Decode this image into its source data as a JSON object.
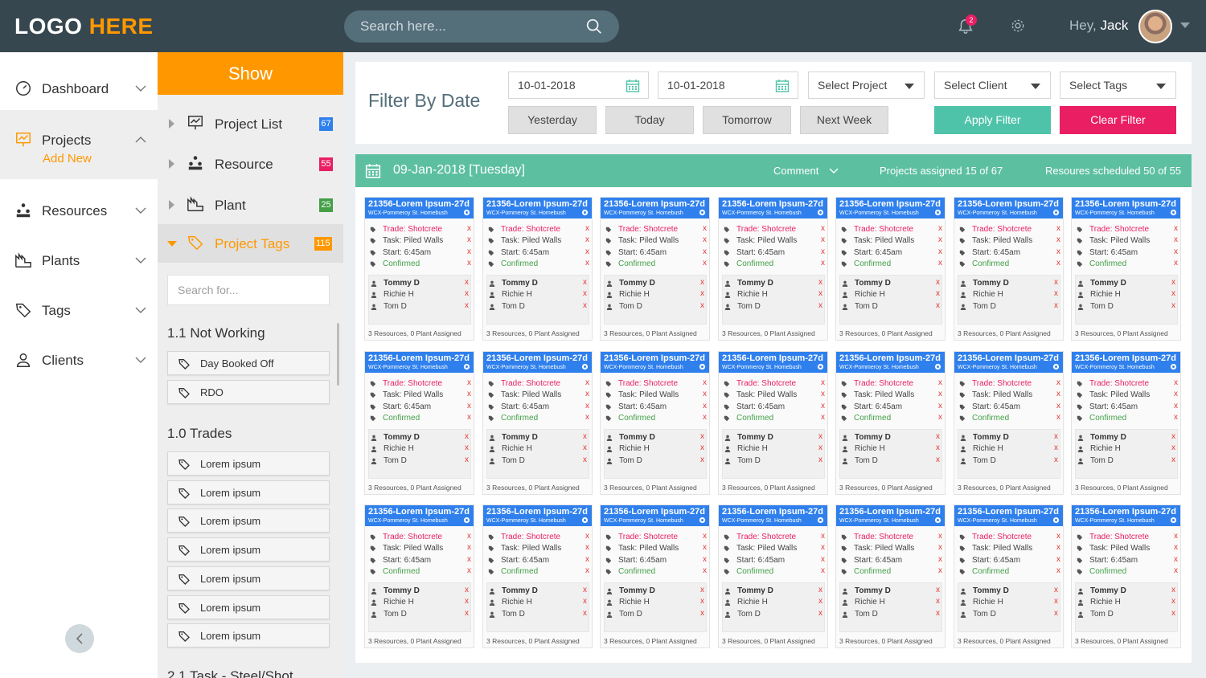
{
  "header": {
    "logo_main": "LOGO",
    "logo_accent": "HERE",
    "search_placeholder": "Search here...",
    "notifications_count": "2",
    "greeting": "Hey,",
    "user_name": "Jack"
  },
  "leftnav": {
    "items": [
      {
        "label": "Dashboard",
        "icon": "dashboard-icon"
      },
      {
        "label": "Projects",
        "icon": "projects-icon",
        "sub": "Add New"
      },
      {
        "label": "Resources",
        "icon": "resources-icon"
      },
      {
        "label": "Plants",
        "icon": "plants-icon"
      },
      {
        "label": "Tags",
        "icon": "tags-icon"
      },
      {
        "label": "Clients",
        "icon": "clients-icon"
      }
    ]
  },
  "show": {
    "title": "Show",
    "tree": [
      {
        "label": "Project List",
        "count": "67",
        "color": "#2f80ed"
      },
      {
        "label": "Resource",
        "count": "55",
        "color": "#e91e63"
      },
      {
        "label": "Plant",
        "count": "25",
        "color": "#43a047"
      },
      {
        "label": "Project Tags",
        "count": "115",
        "color": "#ff9800"
      }
    ],
    "search_placeholder": "Search for...",
    "section_not_working": "1.1 Not Working",
    "not_working": [
      "Day Booked Off",
      "RDO"
    ],
    "section_trades": "1.0 Trades",
    "trades": [
      "Lorem ipsum",
      "Lorem ipsum",
      "Lorem ipsum",
      "Lorem ipsum",
      "Lorem ipsum",
      "Lorem ipsum",
      "Lorem ipsum"
    ],
    "section_task": "2.1 Task - Steel/Shot"
  },
  "filter": {
    "title": "Filter By Date",
    "date_from": "10-01-2018",
    "date_to": "10-01-2018",
    "select_project": "Select Project",
    "select_client": "Select Client",
    "select_tags": "Select Tags",
    "quick": [
      "Yesterday",
      "Today",
      "Tomorrow",
      "Next Week"
    ],
    "apply": "Apply Filter",
    "clear": "Clear Filter"
  },
  "schedule": {
    "date": "09-Jan-2018 [Tuesday]",
    "comment": "Comment",
    "assigned": "Projects assigned 15 of 67",
    "resources": "Resoures scheduled 50 of 55",
    "card": {
      "title": "21356-Lorem Ipsum-27d",
      "subtitle": "WCX-Pommeroy St. Homebush",
      "trade": "Trade: Shotcrete",
      "task": "Task: Piled Walls",
      "start": "Start: 6:45am",
      "status": "Confirmed",
      "people": [
        "Tommy D",
        "Richie H",
        "Tom D"
      ],
      "remove": "x",
      "footer": "3 Resources, 0 Plant Assigned"
    }
  }
}
